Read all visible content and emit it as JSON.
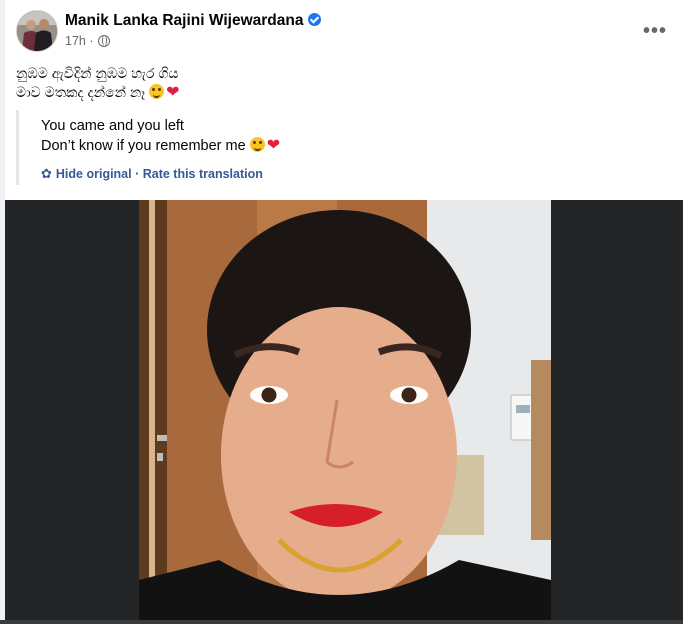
{
  "post": {
    "author": "Manik Lanka Rajini Wijewardana",
    "verified": true,
    "time": "17h",
    "separator": "·",
    "audience_icon": "globe-icon",
    "more_icon": "more-options-icon",
    "more_label": "•••"
  },
  "content": {
    "original_line_1": "නුඹම ඇවිදින් නුඹම හැර ගිය",
    "original_line_2": "මාව මතකද දන්නේ නෑ",
    "translation_line_1": "You came and you left",
    "translation_line_2": "Don’t know if you remember me",
    "emoji_1": "wink-face",
    "emoji_2": "red-heart",
    "heart": "❤"
  },
  "translation_actions": {
    "settings_icon": "gear-icon",
    "gear_glyph": "✿",
    "hide_original": "Hide original",
    "separator": " · ",
    "rate": "Rate this translation"
  },
  "colors": {
    "link": "#385898",
    "verified": "#1877f2",
    "heart": "#e41e3f",
    "photo_bg": "#242526"
  }
}
